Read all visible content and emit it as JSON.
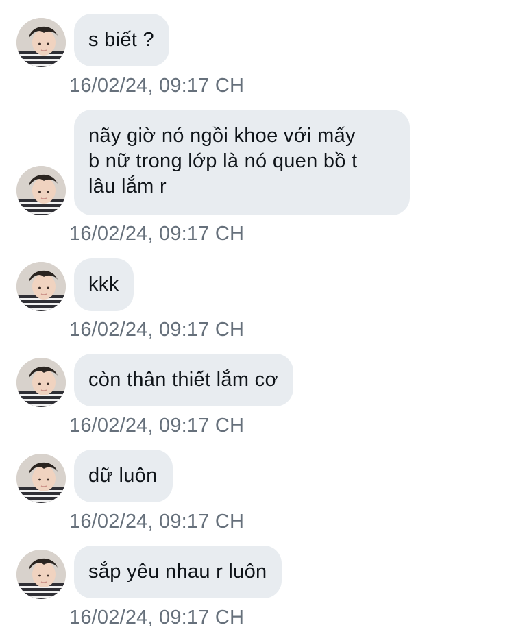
{
  "conversation": {
    "messages": [
      {
        "text": "s biết ?",
        "timestamp": "16/02/24, 09:17 CH"
      },
      {
        "text": "nãy giờ nó ngồi khoe với mấy\nb nữ trong lớp là nó quen bồ t\nlâu lắm r",
        "timestamp": "16/02/24, 09:17 CH"
      },
      {
        "text": "kkk",
        "timestamp": "16/02/24, 09:17 CH"
      },
      {
        "text": "còn thân thiết lắm cơ",
        "timestamp": "16/02/24, 09:17 CH"
      },
      {
        "text": "dữ luôn",
        "timestamp": "16/02/24, 09:17 CH"
      },
      {
        "text": "sắp yêu nhau r luôn",
        "timestamp": "16/02/24, 09:17 CH"
      }
    ]
  },
  "colors": {
    "bubble_background": "#e8ecf0",
    "message_text": "#0f1419",
    "timestamp_text": "#66707b",
    "page_background": "#ffffff"
  },
  "icons": {
    "avatar": "profile-photo"
  }
}
